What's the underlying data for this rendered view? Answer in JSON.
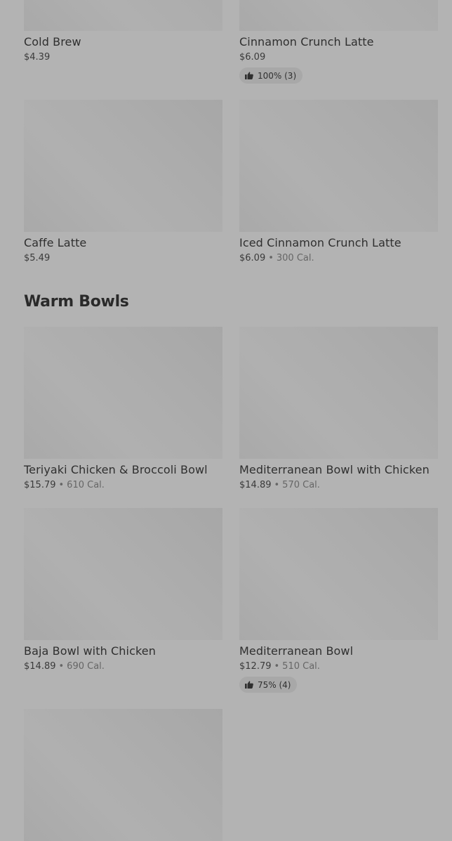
{
  "items_top": [
    {
      "name": "Cold Brew",
      "price": "$4.39",
      "calories": "",
      "rating": ""
    },
    {
      "name": "Cinnamon Crunch Latte",
      "price": "$6.09",
      "calories": "",
      "rating": "100% (3)"
    },
    {
      "name": "Caffe Latte",
      "price": "$5.49",
      "calories": "",
      "rating": ""
    },
    {
      "name": "Iced Cinnamon Crunch Latte",
      "price": "$6.09",
      "calories": "300 Cal.",
      "rating": ""
    }
  ],
  "section": {
    "title": "Warm Bowls"
  },
  "items_warm": [
    {
      "name": "Teriyaki Chicken & Broccoli Bowl",
      "price": "$15.79",
      "calories": "610 Cal.",
      "rating": ""
    },
    {
      "name": "Mediterranean Bowl with Chicken",
      "price": "$14.89",
      "calories": "570 Cal.",
      "rating": ""
    },
    {
      "name": "Baja Bowl with Chicken",
      "price": "$14.89",
      "calories": "690 Cal.",
      "rating": ""
    },
    {
      "name": "Mediterranean Bowl",
      "price": "$12.79",
      "calories": "510 Cal.",
      "rating": "75% (4)"
    },
    {
      "name": "",
      "price": "",
      "calories": "",
      "rating": ""
    }
  ],
  "icons": {
    "rating": "thumbs-up-icon"
  },
  "colors": {
    "page_background": "#b3b3b3",
    "image_placeholder": "#adadad",
    "badge_background": "#a8a8a8",
    "title_text": "#2a2a2a",
    "secondary_text": "#666666"
  }
}
